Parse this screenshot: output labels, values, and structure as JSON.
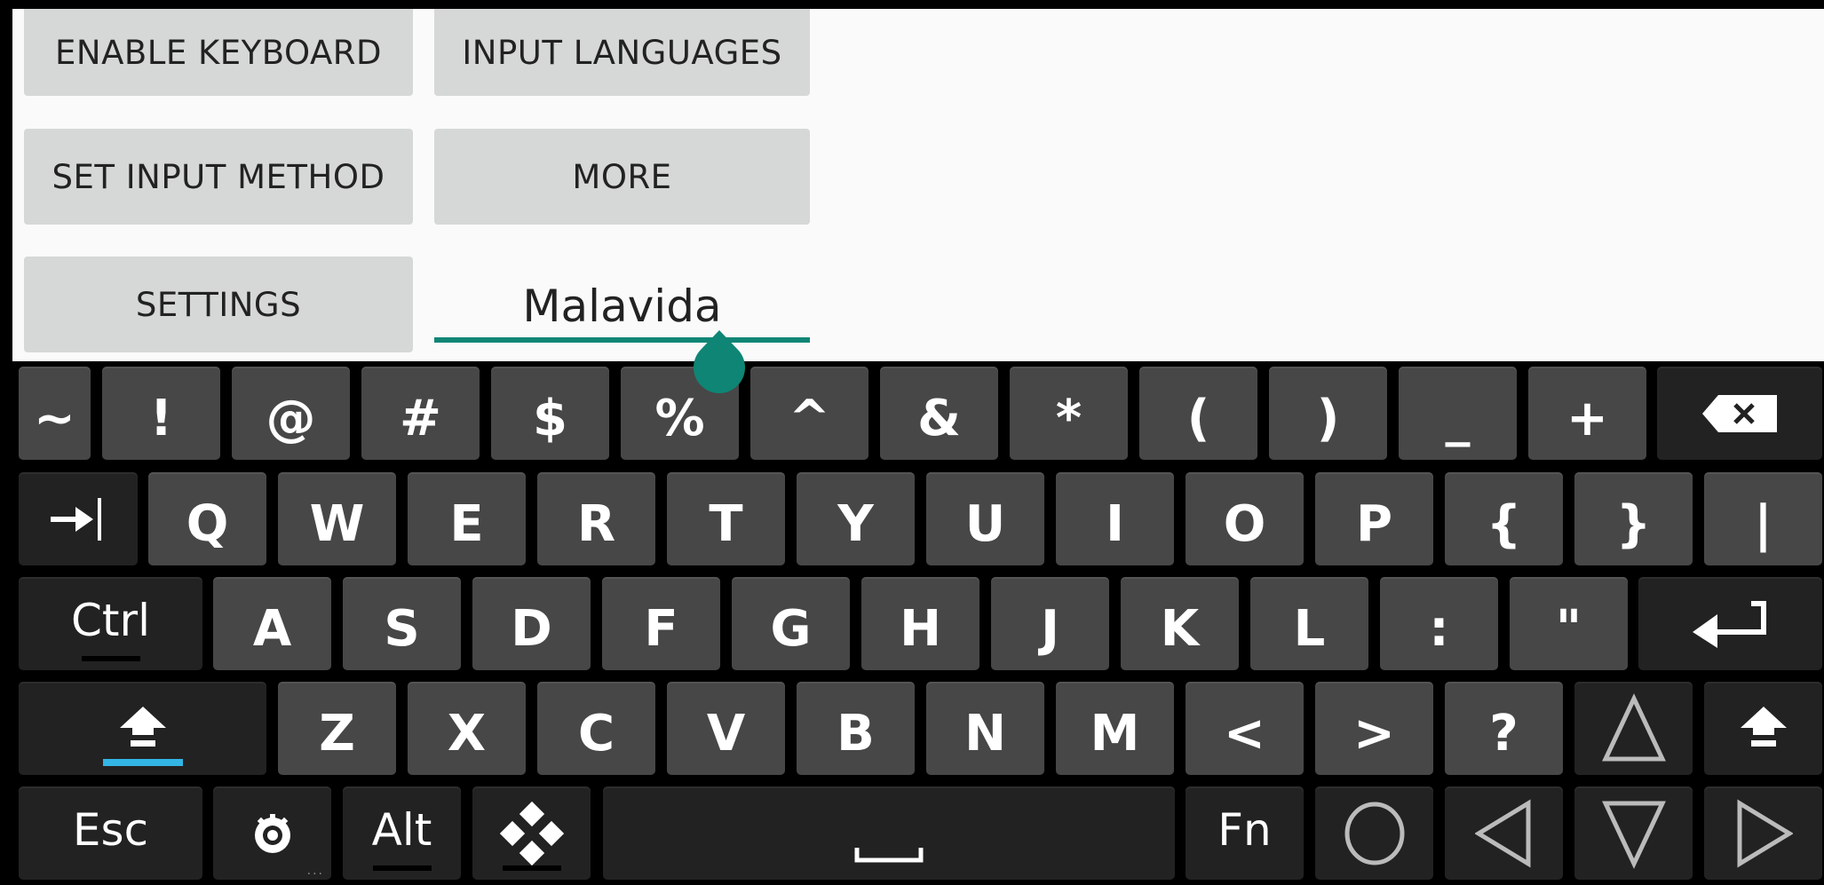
{
  "panel": {
    "buttons": [
      {
        "id": "enable-keyboard",
        "label": "ENABLE KEYBOARD"
      },
      {
        "id": "input-languages",
        "label": "INPUT LANGUAGES"
      },
      {
        "id": "set-input-method",
        "label": "SET INPUT METHOD"
      },
      {
        "id": "more",
        "label": "MORE"
      },
      {
        "id": "settings",
        "label": "SETTINGS"
      }
    ],
    "input": {
      "value": "Malavida"
    }
  },
  "colors": {
    "accent": "#0f8575",
    "shift_active": "#33b5e5",
    "key": "#474747",
    "key_dark": "#222222",
    "panel_bg": "#fafafa",
    "button_bg": "#d6d7d7"
  },
  "keyboard": {
    "row1": [
      "~",
      "!",
      "@",
      "#",
      "$",
      "%",
      "^",
      "&",
      "*",
      "(",
      ")",
      "_",
      "+"
    ],
    "row2": [
      "Q",
      "W",
      "E",
      "R",
      "T",
      "Y",
      "U",
      "I",
      "O",
      "P",
      "{",
      "}",
      "|"
    ],
    "row3": [
      "A",
      "S",
      "D",
      "F",
      "G",
      "H",
      "J",
      "K",
      "L",
      ":",
      "\""
    ],
    "row4": [
      "Z",
      "X",
      "C",
      "V",
      "B",
      "N",
      "M",
      "<",
      ">",
      "?"
    ],
    "modifiers": {
      "ctrl": "Ctrl",
      "esc": "Esc",
      "alt": "Alt",
      "fn": "Fn",
      "settings_hint": "..."
    },
    "icons": {
      "backspace": "backspace-icon",
      "tab": "tab-icon",
      "enter": "enter-icon",
      "shift": "shift-icon",
      "arrow_up": "arrow-up-icon",
      "arrow_left": "arrow-left-icon",
      "arrow_down": "arrow-down-icon",
      "arrow_right": "arrow-right-icon",
      "circle": "circle-icon",
      "gear": "gear-icon",
      "dpad": "dpad-icon",
      "space": "space-icon"
    },
    "state": {
      "shift_active": true,
      "ctrl_active": false,
      "alt_active": false
    }
  }
}
